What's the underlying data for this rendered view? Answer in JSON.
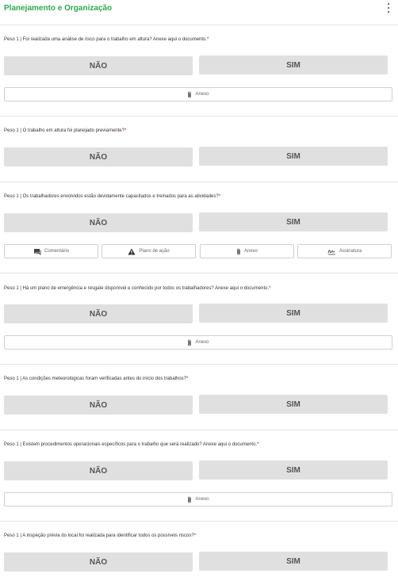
{
  "header": {
    "title": "Planejamento e Organização"
  },
  "labels": {
    "nao": "NÃO",
    "sim": "SIM",
    "anexo": "Anexo",
    "comentario": "Comentário",
    "plano": "Plano de ação",
    "assinatura": "Assinatura",
    "required_mark": "*"
  },
  "questions": [
    {
      "text": "Peso 1 | Foi realizada uma análise de risco para o trabalho em altura? Anexe aqui o documento."
    },
    {
      "text": "Peso 1 | O trabalho em altura foi planejado previamente?"
    },
    {
      "text": "Peso 1 | Os trabalhadores envolvidos estão devidamente capacitados e treinados para as atividades?"
    },
    {
      "text": "Peso 1 | Há um plano de emergência e resgate disponível e conhecido por todos os trabalhadores? Anexe aqui o documento."
    },
    {
      "text": "Peso 1 | As condições meteorológicas foram verificadas antes do início dos trabalhos?"
    },
    {
      "text": "Peso 1 | Existem procedimentos operacionais específicos para o trabalho que será realizado? Anexe aqui o documento."
    },
    {
      "text": "Peso 1 | A inspeção prévia do local foi realizada para identificar todos os possíveis riscos?"
    }
  ],
  "colors": {
    "accent": "#2fa84f",
    "required": "#d0021b",
    "option_bg": "#e0e0e0"
  },
  "icons": {
    "menu": "kebab-menu-icon",
    "attach": "paperclip-icon",
    "comment": "comment-icon",
    "warning": "warning-icon",
    "signature": "signature-icon"
  }
}
